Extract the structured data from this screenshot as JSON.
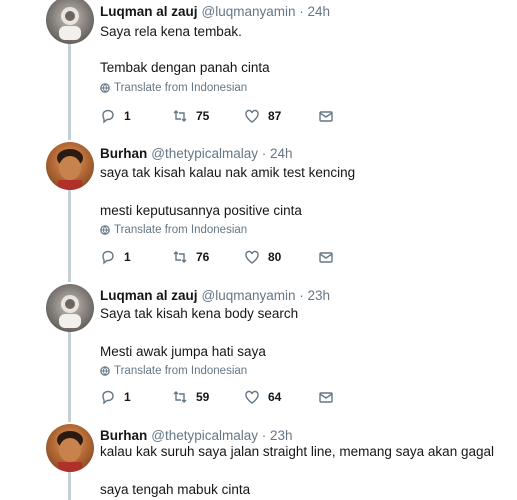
{
  "tweets": [
    {
      "name": "Luqman al zauj",
      "handle": "@luqmanyamin · 24h",
      "line1": "Saya rela kena tembak.",
      "line2": "Tembak dengan panah cinta",
      "translate": "Translate from Indonesian",
      "reply_count": "1",
      "retweet_count": "75",
      "like_count": "87"
    },
    {
      "name": "Burhan",
      "handle": "@thetypicalmalay · 24h",
      "line1": "saya tak kisah kalau nak amik test kencing",
      "line2": "mesti keputusannya positive cinta",
      "translate": "Translate from Indonesian",
      "reply_count": "1",
      "retweet_count": "76",
      "like_count": "80"
    },
    {
      "name": "Luqman al zauj",
      "handle": "@luqmanyamin · 23h",
      "line1": "Saya tak kisah kena body search",
      "line2": "Mesti awak jumpa hati saya",
      "translate": "Translate from Indonesian",
      "reply_count": "1",
      "retweet_count": "59",
      "like_count": "64"
    },
    {
      "name": "Burhan",
      "handle": "@thetypicalmalay · 23h",
      "line1": "kalau kak suruh saya jalan straight line, memang saya akan gagal",
      "line2": "saya tengah mabuk cinta"
    }
  ],
  "icons": {
    "reply": "reply-icon",
    "retweet": "retweet-icon",
    "like": "heart-icon",
    "dm": "envelope-icon",
    "translate": "globe-icon"
  }
}
